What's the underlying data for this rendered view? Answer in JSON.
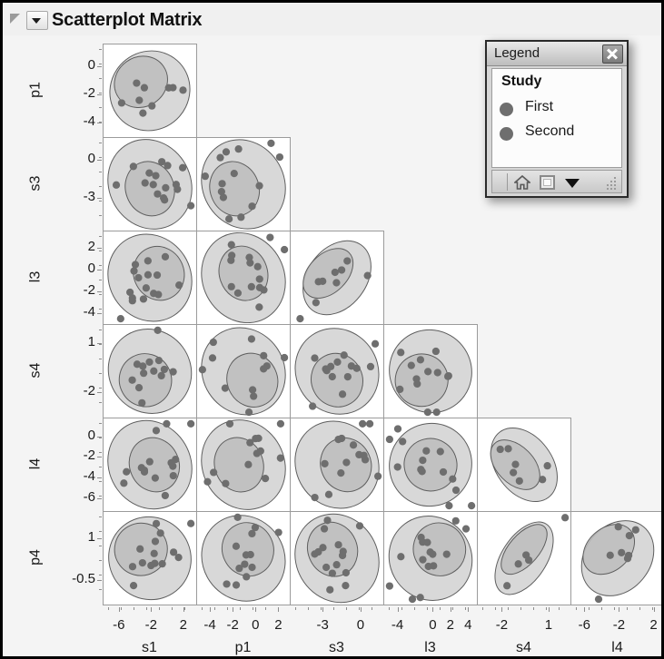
{
  "window": {
    "title": "Scatterplot Matrix",
    "disclosure_icon": "disclosure-triangle-icon",
    "dropdown_icon": "chevron-down-icon"
  },
  "legend": {
    "title": "Legend",
    "close_icon": "close-icon",
    "heading": "Study",
    "items": [
      {
        "label": "First",
        "color": "#6e6e6e"
      },
      {
        "label": "Second",
        "color": "#6e6e6e"
      }
    ],
    "toolbar": {
      "home_icon": "home-icon",
      "square_icon": "square-outline-icon",
      "arrow_icon": "triangle-down-icon",
      "grip_icon": "resize-grip-icon"
    }
  },
  "chart_data": {
    "type": "scatter",
    "title": "Scatterplot Matrix",
    "subtype": "scatterplot-matrix-with-density-ellipses",
    "grid": false,
    "legend_position": "floating-top-right",
    "point_color": "#6e6e6e",
    "ellipse_outer_fill": "#d8d8d8",
    "ellipse_inner_fill": "#bdbdbd",
    "ellipse_stroke": "#5d5d5d",
    "groups": [
      "First",
      "Second"
    ],
    "variables": [
      "s1",
      "p1",
      "s3",
      "l3",
      "s4",
      "l4",
      "p4"
    ],
    "row_variables": [
      "p1",
      "s3",
      "l3",
      "s4",
      "l4",
      "p4"
    ],
    "column_variables": [
      "s1",
      "p1",
      "s3",
      "l3",
      "s4",
      "l4"
    ],
    "y_axes": {
      "p1": {
        "ticks": [
          0,
          -2,
          -4
        ],
        "range": [
          -5.0,
          1.6
        ]
      },
      "s3": {
        "ticks": [
          0,
          -3
        ],
        "range": [
          -5.6,
          1.8
        ]
      },
      "l3": {
        "ticks": [
          2,
          0,
          -2,
          -4
        ],
        "range": [
          -5.0,
          3.6
        ]
      },
      "s4": {
        "ticks": [
          1,
          -2
        ],
        "range": [
          -3.6,
          2.2
        ]
      },
      "l4": {
        "ticks": [
          0,
          -2,
          -4,
          -6
        ],
        "range": [
          -7.2,
          1.8
        ]
      },
      "p4": {
        "ticks": [
          1,
          -0.5
        ],
        "range": [
          -1.4,
          2.0
        ]
      }
    },
    "x_axes": {
      "s1": {
        "ticks": [
          -6,
          -2,
          2
        ],
        "range": [
          -8.0,
          3.6
        ]
      },
      "p1": {
        "ticks": [
          -4,
          -2,
          0,
          2
        ],
        "range": [
          -5.2,
          3.0
        ]
      },
      "s3": {
        "ticks": [
          -3,
          0
        ],
        "range": [
          -5.6,
          1.8
        ]
      },
      "l3": {
        "ticks": [
          -4,
          0,
          2,
          4
        ],
        "range": [
          -5.6,
          5.0
        ]
      },
      "s4": {
        "ticks": [
          -2,
          1
        ],
        "range": [
          -3.6,
          2.4
        ]
      },
      "l4": {
        "ticks": [
          -6,
          -2,
          2
        ],
        "range": [
          -7.6,
          3.2
        ]
      }
    },
    "cells": [
      {
        "row": "p1",
        "col": "s1",
        "r": 0.55,
        "n_points": 9
      },
      {
        "row": "s3",
        "col": "s1",
        "r": 0.2,
        "n_points": 16
      },
      {
        "row": "s3",
        "col": "p1",
        "r": 0.22,
        "n_points": 14
      },
      {
        "row": "l3",
        "col": "s1",
        "r": 0.3,
        "n_points": 16
      },
      {
        "row": "l3",
        "col": "p1",
        "r": 0.18,
        "n_points": 15
      },
      {
        "row": "l3",
        "col": "s3",
        "r": 0.78,
        "n_points": 9
      },
      {
        "row": "s4",
        "col": "s1",
        "r": 0.4,
        "n_points": 13
      },
      {
        "row": "s4",
        "col": "p1",
        "r": 0.3,
        "n_points": 12
      },
      {
        "row": "s4",
        "col": "s3",
        "r": 0.35,
        "n_points": 14
      },
      {
        "row": "s4",
        "col": "l3",
        "r": 0.45,
        "n_points": 13
      },
      {
        "row": "l4",
        "col": "s1",
        "r": 0.25,
        "n_points": 15
      },
      {
        "row": "l4",
        "col": "p1",
        "r": 0.2,
        "n_points": 13
      },
      {
        "row": "l4",
        "col": "s3",
        "r": 0.3,
        "n_points": 14
      },
      {
        "row": "l4",
        "col": "l3",
        "r": -0.45,
        "n_points": 14
      },
      {
        "row": "l4",
        "col": "s4",
        "r": -0.8,
        "n_points": 7
      },
      {
        "row": "p4",
        "col": "s1",
        "r": 0.45,
        "n_points": 14
      },
      {
        "row": "p4",
        "col": "p1",
        "r": 0.35,
        "n_points": 13
      },
      {
        "row": "p4",
        "col": "s3",
        "r": 0.25,
        "n_points": 15
      },
      {
        "row": "p4",
        "col": "l3",
        "r": 0.4,
        "n_points": 15
      },
      {
        "row": "p4",
        "col": "s4",
        "r": 0.88,
        "n_points": 5
      },
      {
        "row": "p4",
        "col": "l4",
        "r": 0.72,
        "n_points": 8
      }
    ]
  }
}
